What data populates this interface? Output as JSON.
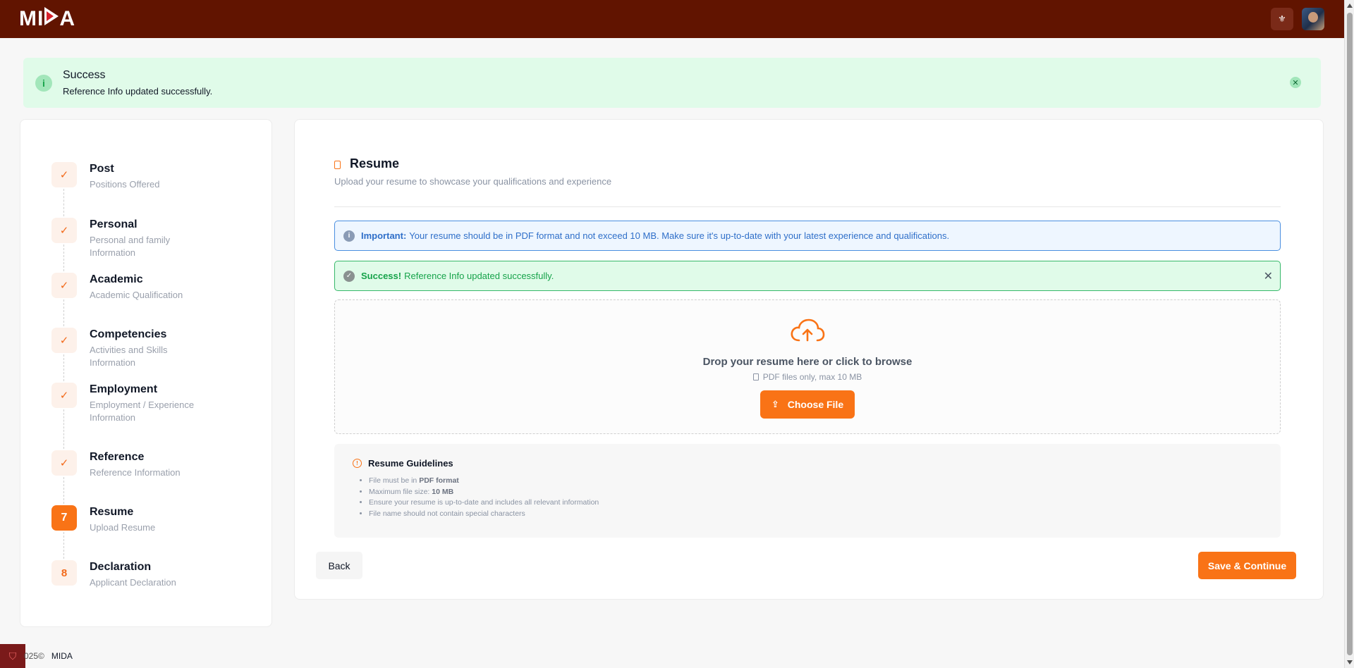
{
  "header": {
    "logo_text": "MIDA",
    "flag_icon": "emblem-icon",
    "avatar": "user-avatar"
  },
  "top_alert": {
    "title": "Success",
    "message": "Reference Info updated successfully.",
    "icon": "info-icon"
  },
  "steps": [
    {
      "marker": "✓",
      "title": "Post",
      "subtitle": "Positions Offered",
      "state": "done"
    },
    {
      "marker": "✓",
      "title": "Personal",
      "subtitle": "Personal and family Information",
      "state": "done"
    },
    {
      "marker": "✓",
      "title": "Academic",
      "subtitle": "Academic Qualification",
      "state": "done"
    },
    {
      "marker": "✓",
      "title": "Competencies",
      "subtitle": "Activities and Skills Information",
      "state": "done"
    },
    {
      "marker": "✓",
      "title": "Employment",
      "subtitle": "Employment / Experience Information",
      "state": "done"
    },
    {
      "marker": "✓",
      "title": "Reference",
      "subtitle": "Reference Information",
      "state": "done"
    },
    {
      "marker": "7",
      "title": "Resume",
      "subtitle": "Upload Resume",
      "state": "active"
    },
    {
      "marker": "8",
      "title": "Declaration",
      "subtitle": "Applicant Declaration",
      "state": "pending"
    }
  ],
  "main": {
    "title": "Resume",
    "subtitle": "Upload your resume to showcase your qualifications and experience",
    "important_label": "Important:",
    "important_text": "Your resume should be in PDF format and not exceed 10 MB. Make sure it's up-to-date with your latest experience and qualifications.",
    "success_label": "Success!",
    "success_text": "Reference Info updated successfully.",
    "dropzone_title": "Drop your resume here or click to browse",
    "dropzone_hint": "PDF files only, max 10 MB",
    "choose_label": "Choose File",
    "guidelines_title": "Resume Guidelines",
    "guidelines": [
      {
        "pre": "File must be in ",
        "bold": "PDF format",
        "post": ""
      },
      {
        "pre": "Maximum file size: ",
        "bold": "10 MB",
        "post": ""
      },
      {
        "pre": "Ensure your resume is up-to-date and includes all relevant information",
        "bold": "",
        "post": ""
      },
      {
        "pre": "File name should not contain special characters",
        "bold": "",
        "post": ""
      }
    ],
    "back_label": "Back",
    "save_label": "Save & Continue"
  },
  "footer": {
    "copyright": "025©",
    "brand": "MIDA"
  },
  "colors": {
    "header_bg": "#611400",
    "accent": "#f97316",
    "success_bg": "#e0fbe9",
    "info_border": "#4a8fe0"
  }
}
